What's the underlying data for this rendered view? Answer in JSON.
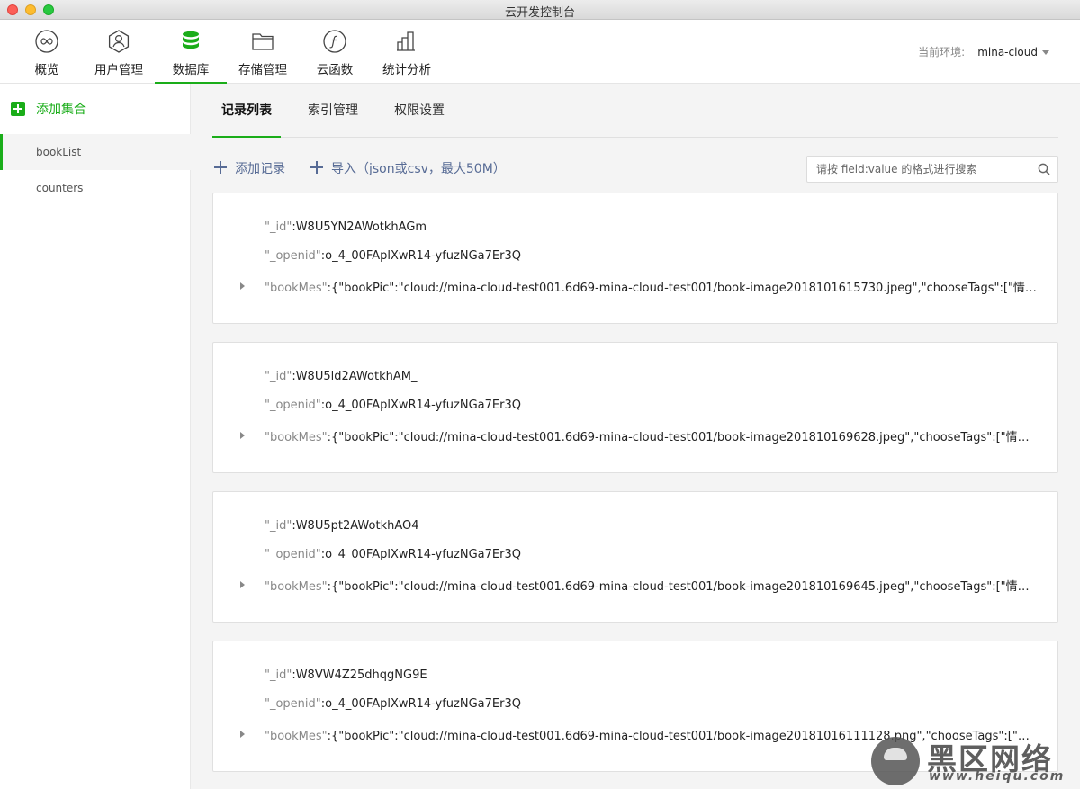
{
  "window": {
    "title": "云开发控制台"
  },
  "toolbar": {
    "items": [
      {
        "label": "概览",
        "icon": "infinity-icon"
      },
      {
        "label": "用户管理",
        "icon": "user-icon"
      },
      {
        "label": "数据库",
        "icon": "database-icon"
      },
      {
        "label": "存储管理",
        "icon": "folder-icon"
      },
      {
        "label": "云函数",
        "icon": "function-icon"
      },
      {
        "label": "统计分析",
        "icon": "bar-chart-icon"
      }
    ],
    "active_index": 2,
    "env_label": "当前环境:",
    "env_value": "mina-cloud"
  },
  "sidebar": {
    "add_label": "添加集合",
    "collections": [
      "bookList",
      "counters"
    ],
    "active_index": 0
  },
  "tabs": [
    "记录列表",
    "索引管理",
    "权限设置"
  ],
  "active_tab": 0,
  "actions": {
    "add_record": "添加记录",
    "import": "导入（json或csv，最大50M）"
  },
  "search": {
    "placeholder": "请按 field:value 的格式进行搜索"
  },
  "records": [
    {
      "id_key": "\"_id\"",
      "id": ":W8U5YN2AWotkhAGm",
      "openid_key": "\"_openid\"",
      "openid": ":o_4_00FAplXwR14-yfuzNGa7Er3Q",
      "mes_key": "\"bookMes\"",
      "mes": ":{\"bookPic\":\"cloud://mina-cloud-test001.6d69-mina-cloud-test001/book-image2018101615730.jpeg\",\"chooseTags\":[\"情感\"],\"na…"
    },
    {
      "id_key": "\"_id\"",
      "id": ":W8U5ld2AWotkhAM_",
      "openid_key": "\"_openid\"",
      "openid": ":o_4_00FAplXwR14-yfuzNGa7Er3Q",
      "mes_key": "\"bookMes\"",
      "mes": ":{\"bookPic\":\"cloud://mina-cloud-test001.6d69-mina-cloud-test001/book-image201810169628.jpeg\",\"chooseTags\":[\"情感\"],\"nam…"
    },
    {
      "id_key": "\"_id\"",
      "id": ":W8U5pt2AWotkhAO4",
      "openid_key": "\"_openid\"",
      "openid": ":o_4_00FAplXwR14-yfuzNGa7Er3Q",
      "mes_key": "\"bookMes\"",
      "mes": ":{\"bookPic\":\"cloud://mina-cloud-test001.6d69-mina-cloud-test001/book-image201810169645.jpeg\",\"chooseTags\":[\"情感\",\"社会\"…"
    },
    {
      "id_key": "\"_id\"",
      "id": ":W8VW4Z25dhqgNG9E",
      "openid_key": "\"_openid\"",
      "openid": ":o_4_00FAplXwR14-yfuzNGa7Er3Q",
      "mes_key": "\"bookMes\"",
      "mes": ":{\"bookPic\":\"cloud://mina-cloud-test001.6d69-mina-cloud-test001/book-image20181016111128.png\",\"chooseTags\":[\"社会\"],\"na…"
    }
  ],
  "watermark": {
    "title": "黑区网络",
    "url": "www.heiqu.com"
  },
  "colors": {
    "accent": "#1aad19",
    "link": "#576b95"
  }
}
